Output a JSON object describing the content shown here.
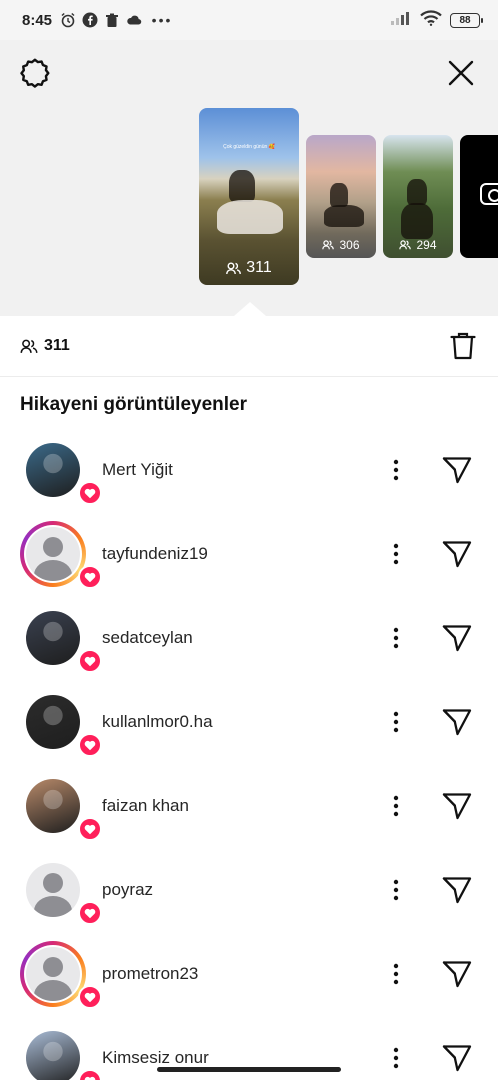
{
  "status_bar": {
    "time": "8:45",
    "battery": "88",
    "left_icons": [
      "alarm-icon",
      "facebook-icon",
      "trash-notification-icon",
      "cloud-icon"
    ],
    "right_icons": [
      "signal-icon",
      "wifi-icon",
      "battery-icon"
    ]
  },
  "header": {
    "settings_icon": "gear-icon",
    "close_icon": "close-icon"
  },
  "stories": [
    {
      "count": "311",
      "caption": "Çok güzeldin günün 🥰",
      "selected": true
    },
    {
      "count": "306"
    },
    {
      "count": "294"
    },
    {
      "type": "camera"
    }
  ],
  "viewers_summary": {
    "count": "311",
    "delete_icon": "trash-icon"
  },
  "section_title": "Hikayeni görüntüleyenler",
  "viewers": [
    {
      "username": "Mert Yiğit",
      "ring": false,
      "avatar": "photo",
      "avatar_color": "#3b6a8a"
    },
    {
      "username": "tayfundeniz19",
      "ring": true,
      "avatar": "default"
    },
    {
      "username": "sedatceylan",
      "ring": false,
      "avatar": "photo",
      "avatar_color": "#3a4150"
    },
    {
      "username": "kullanlmor0.ha",
      "ring": false,
      "avatar": "photo",
      "avatar_color": "#2c2c2c"
    },
    {
      "username": "faizan khan",
      "ring": false,
      "avatar": "photo",
      "avatar_color": "#b88a6a"
    },
    {
      "username": "poyraz",
      "ring": false,
      "avatar": "default"
    },
    {
      "username": "prometron23",
      "ring": true,
      "avatar": "default"
    },
    {
      "username": "Kimsesiz onur",
      "ring": false,
      "avatar": "photo",
      "avatar_color": "#a9bcd6"
    }
  ],
  "colors": {
    "heart_badge": "#ff1f5a",
    "top_area_bg": "#f1f1f1"
  }
}
